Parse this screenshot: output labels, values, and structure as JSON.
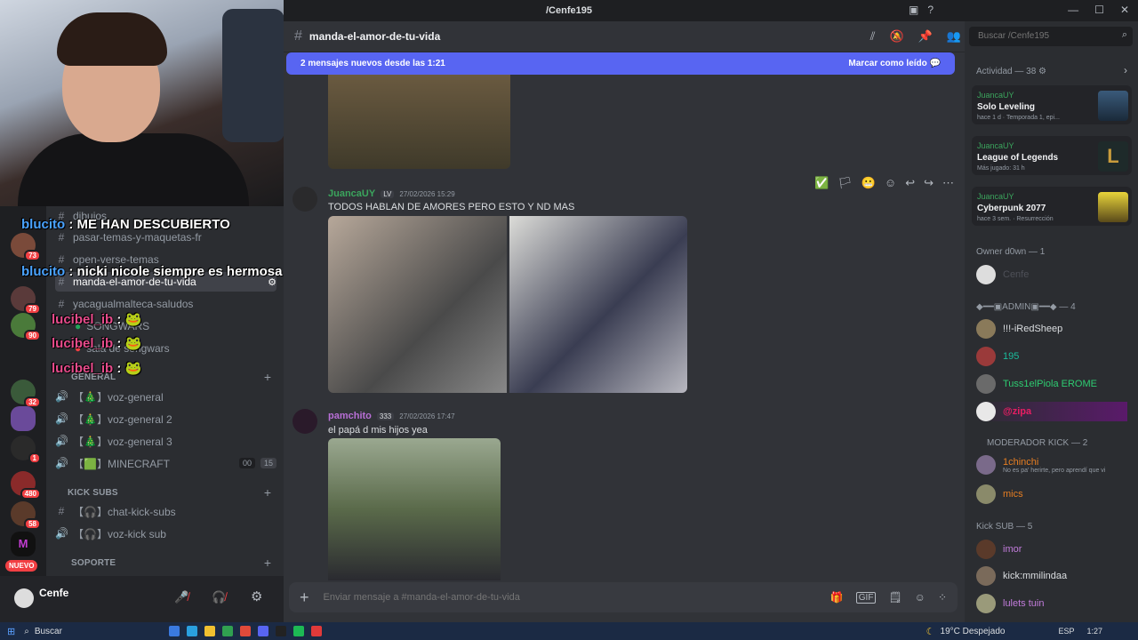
{
  "window": {
    "title": "/Cenfe195"
  },
  "channel": {
    "name": "manda-el-amor-de-tu-vida"
  },
  "search": {
    "placeholder": "Buscar /Cenfe195"
  },
  "new_messages_bar": {
    "text": "2 mensajes nuevos desde las 1:21",
    "action": "Marcar como leído"
  },
  "sidebar": {
    "text_channels": [
      "dibujos",
      "pasar-temas-y-maquetas-fr",
      "open-verse-temas",
      "manda-el-amor-de-tu-vida",
      "yacagualmalteca-saludos"
    ],
    "other_channels": [
      "SONGWARS",
      "sala de songwars"
    ],
    "general_category": "GENERAL",
    "voice_channels": [
      "【🎄】voz-general",
      "【🎄】voz-general 2",
      "【🎄】voz-general 3",
      "【🟩】MINECRAFT"
    ],
    "minecraft_counts": [
      "00",
      "15"
    ],
    "kick_category": "KICK SUBS",
    "kick_channels": [
      "【🎧】chat-kick-subs",
      "【🎧】voz-kick sub"
    ],
    "support_category": "SOPORTE"
  },
  "overlay_chat": [
    {
      "user": "blucito",
      "message": "ME HAN DESCUBIERTO"
    },
    {
      "user": "blucito",
      "message": "nicki nicole siempre es hermosa"
    },
    {
      "user": "lucibel_ib",
      "message": ""
    },
    {
      "user": "lucibel_ib",
      "message": ""
    },
    {
      "user": "lucibel_ib",
      "message": ""
    }
  ],
  "server_badges": [
    "73",
    "79",
    "90",
    "32",
    "1",
    "480",
    "58"
  ],
  "new_label": "NUEVO",
  "user_panel": {
    "name": "Cenfe"
  },
  "messages": [
    {
      "author": "JuancaUY",
      "tag": "LV",
      "timestamp": "27/02/2026 15:29",
      "text": "TODOS HABLAN DE AMORES PERO ESTO Y ND MAS",
      "author_color": "#3ba55d"
    },
    {
      "author": "pamchito",
      "tag": "333",
      "timestamp": "27/02/2026 17:47",
      "text": "el papá d mis hijos yea",
      "author_color": "#b86fd6"
    }
  ],
  "composer": {
    "placeholder": "Enviar mensaje a #manda-el-amor-de-tu-vida"
  },
  "members": {
    "activity_header": "Actividad — 38",
    "activities": [
      {
        "user": "JuancaUY",
        "game": "Solo Leveling",
        "meta": "hace 1 d",
        "extra": "Temporada 1, epi..."
      },
      {
        "user": "JuancaUY",
        "game": "League of Legends",
        "meta": "Más jugado: 31 h",
        "extra": ""
      },
      {
        "user": "JuancaUY",
        "game": "Cyberpunk 2077",
        "meta": "hace 3 sem.",
        "extra": "Resurrección"
      }
    ],
    "owner_header": "Owner d0wn — 1",
    "owner": [
      "Cenfe"
    ],
    "admin_header": "◆━━▣ADMIN▣━━◆ — 4",
    "admins": [
      {
        "name": "!!!-iRedSheep",
        "color": "#dbdee1"
      },
      {
        "name": "195",
        "color": "#1abc9c"
      },
      {
        "name": "Tuss1elPiola EROME",
        "color": "#2ecc71"
      },
      {
        "name": "@zipa",
        "color": "#e91e63"
      }
    ],
    "mod_header": "MODERADOR KICK — 2",
    "mods": [
      {
        "name": "1chinchi",
        "status": "No es pa' herirte, pero aprendí que vi",
        "color": "#e67e22"
      },
      {
        "name": "mics",
        "status": "",
        "color": "#e67e22"
      }
    ],
    "kick_header": "Kick SUB — 5",
    "kick_subs": [
      {
        "name": "imor",
        "color": "#c27cdb"
      },
      {
        "name": "kick:mmilindaa",
        "color": "#dbdee1"
      },
      {
        "name": "lulets tuin",
        "color": "#c27cdb"
      }
    ]
  },
  "taskbar": {
    "search": "Buscar",
    "weather": "19°C Despejado",
    "lang": "ESP",
    "time": "1:27"
  }
}
